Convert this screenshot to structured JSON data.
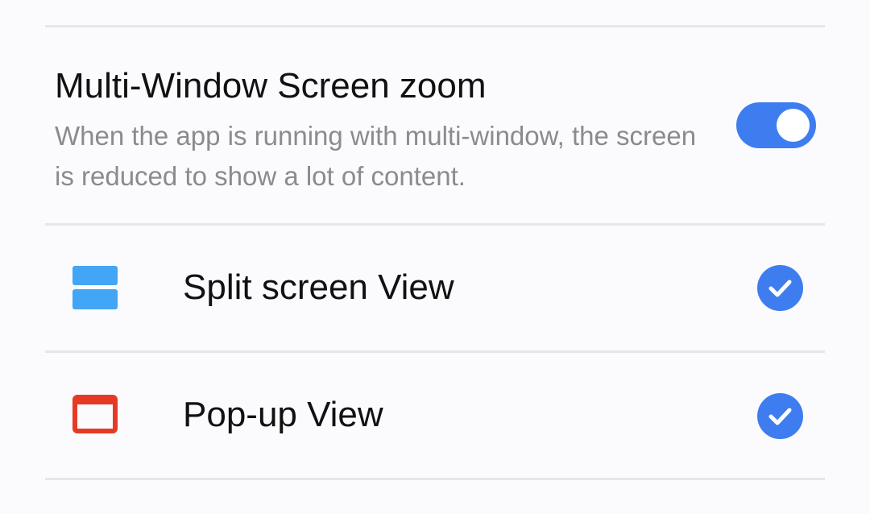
{
  "setting": {
    "title": "Multi-Window Screen zoom",
    "description": "When the app is running with multi-window, the screen is reduced to show a lot of content.",
    "enabled": true
  },
  "options": [
    {
      "label": "Split screen View",
      "icon": "split-screen-icon",
      "icon_color": "#42a5f5",
      "checked": true
    },
    {
      "label": "Pop-up View",
      "icon": "popup-window-icon",
      "icon_color": "#e53a23",
      "checked": true
    }
  ],
  "colors": {
    "accent": "#3e7df0",
    "divider": "#e6e6ea",
    "background": "#fbfafd"
  }
}
